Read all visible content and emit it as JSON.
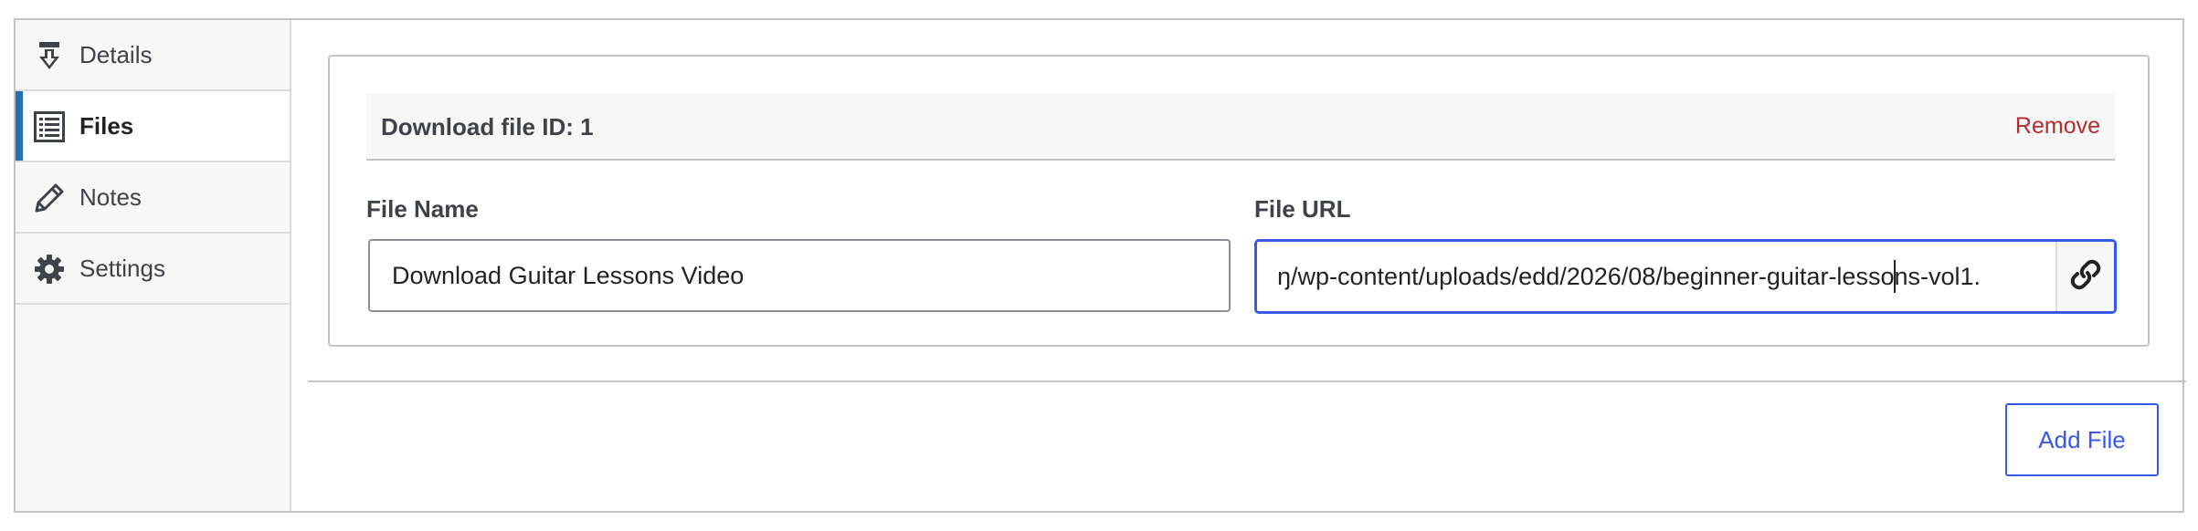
{
  "sidebar": {
    "tabs": [
      {
        "label": "Details",
        "icon": "download-arrow-icon",
        "active": false
      },
      {
        "label": "Files",
        "icon": "list-icon",
        "active": true
      },
      {
        "label": "Notes",
        "icon": "pencil-icon",
        "active": false
      },
      {
        "label": "Settings",
        "icon": "gear-icon",
        "active": false
      }
    ]
  },
  "file_entry": {
    "title": "Download file ID: 1",
    "remove_label": "Remove",
    "name_label": "File Name",
    "name_value": "Download Guitar Lessons Video",
    "url_label": "File URL",
    "url_value_visible": "ŋ/wp-content/uploads/edd/2026/08/beginner-guitar-lessons-vol1.",
    "url_button_icon": "link-icon"
  },
  "actions": {
    "add_file_label": "Add File"
  },
  "colors": {
    "accent": "#3858e9",
    "active_tab_bar": "#2271b1",
    "remove": "#b32d2e",
    "border": "#c3c4c7"
  }
}
